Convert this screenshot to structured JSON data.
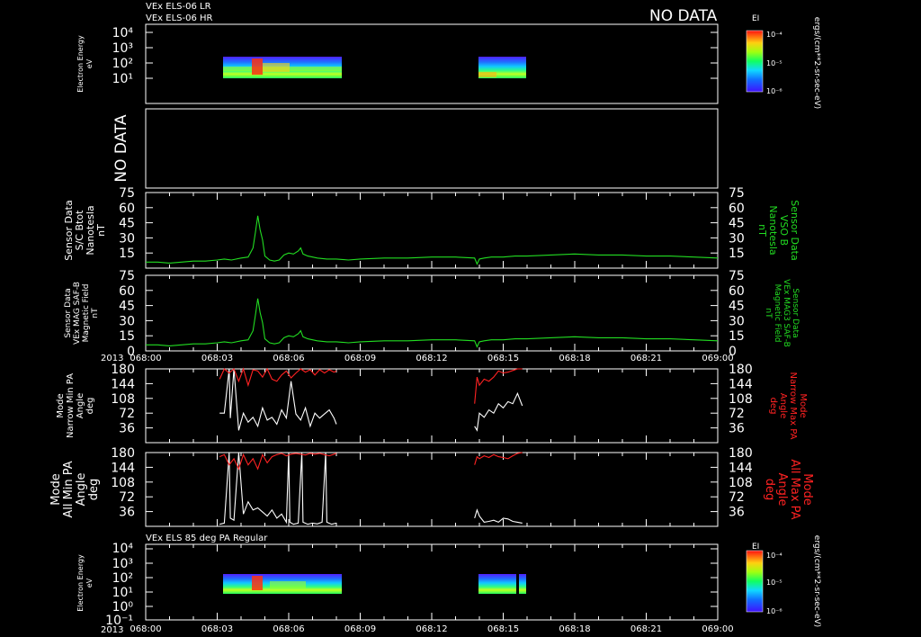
{
  "header": {
    "line1": "VEx ELS-06 LR",
    "line2": "VEx ELS-06 HR",
    "no_data": "NO DATA"
  },
  "year_label": "2013",
  "colorbar": {
    "title": "EI",
    "ticks": [
      "10⁻⁴",
      "10⁻⁵",
      "10⁻⁶"
    ],
    "unit": "ergs/(cm**2-sr-sec-eV)"
  },
  "chart_data": [
    {
      "type": "heatmap",
      "title": "VEx ELS-06 LR / VEx ELS-06 HR",
      "ylabel": [
        "Electron Energy",
        "eV"
      ],
      "yscale": "log",
      "yticks": [
        "10⁴",
        "10³",
        "10²",
        "10¹"
      ],
      "data_intervals": [
        [
          "068:03.3",
          "068:08.0"
        ],
        [
          "068:13.8",
          "068:15.8"
        ]
      ],
      "colorbar": "EI"
    },
    {
      "type": "line",
      "note_text": "NO DATA"
    },
    {
      "type": "line",
      "ylabel": [
        "Sensor Data",
        "S/C Btot",
        "Nanotesla",
        "nT"
      ],
      "ylabel_right": [
        "Sensor Data",
        "VSO B",
        "Nanotesla",
        "nT"
      ],
      "ylim": [
        0,
        75
      ],
      "yticks": [
        15,
        30,
        45,
        60,
        75
      ],
      "series": [
        {
          "name": "B",
          "color": "#22dd22",
          "x": [
            0,
            0.5,
            1.0,
            1.5,
            2.0,
            2.5,
            3.0,
            3.3,
            3.6,
            4.0,
            4.3,
            4.5,
            4.6,
            4.7,
            4.8,
            4.9,
            5.0,
            5.2,
            5.4,
            5.6,
            5.8,
            6.0,
            6.2,
            6.4,
            6.5,
            6.6,
            6.8,
            7.2,
            7.6,
            8.0,
            8.5,
            9.0,
            10.0,
            11.0,
            12.0,
            13.0,
            13.8,
            13.9,
            14.0,
            14.2,
            14.5,
            15.0,
            15.5,
            16.0,
            17.0,
            18.0,
            19.0,
            20.0,
            21.0,
            22.0,
            23.0,
            24.0
          ],
          "y": [
            6,
            6,
            5,
            6,
            7,
            7,
            8,
            9,
            8,
            10,
            11,
            20,
            35,
            52,
            38,
            28,
            12,
            8,
            7,
            8,
            13,
            15,
            14,
            17,
            20,
            14,
            12,
            10,
            9,
            9,
            8,
            9,
            10,
            10,
            11,
            11,
            10,
            4,
            9,
            10,
            11,
            11,
            12,
            12,
            13,
            14,
            13,
            13,
            12,
            12,
            11,
            10
          ]
        }
      ]
    },
    {
      "type": "line",
      "ylabel": [
        "Sensor Data",
        "VEx MAG SAF-B",
        "Magnetic Field",
        "nT"
      ],
      "ylabel_right": [
        "Sensor Data",
        "VEx MAG3 SAF-B",
        "Magnetic Field",
        "nT"
      ],
      "ylim": [
        0,
        75
      ],
      "yticks": [
        0,
        15,
        30,
        45,
        60,
        75
      ],
      "xticks": [
        "068:00",
        "068:03",
        "068:06",
        "068:09",
        "068:12",
        "068:15",
        "068:18",
        "068:21",
        "069:00"
      ],
      "series": [
        {
          "name": "B",
          "color": "#22dd22",
          "x": [
            0,
            0.5,
            1.0,
            1.5,
            2.0,
            2.5,
            3.0,
            3.3,
            3.6,
            4.0,
            4.3,
            4.5,
            4.6,
            4.7,
            4.8,
            4.9,
            5.0,
            5.2,
            5.4,
            5.6,
            5.8,
            6.0,
            6.2,
            6.4,
            6.5,
            6.6,
            6.8,
            7.2,
            7.6,
            8.0,
            8.5,
            9.0,
            10.0,
            11.0,
            12.0,
            13.0,
            13.8,
            13.9,
            14.0,
            14.2,
            14.5,
            15.0,
            15.5,
            16.0,
            17.0,
            18.0,
            19.0,
            20.0,
            21.0,
            22.0,
            23.0,
            24.0
          ],
          "y": [
            6,
            6,
            5,
            6,
            7,
            7,
            8,
            9,
            8,
            10,
            11,
            20,
            35,
            52,
            38,
            28,
            12,
            8,
            7,
            8,
            13,
            15,
            14,
            17,
            20,
            14,
            12,
            10,
            9,
            9,
            8,
            9,
            10,
            10,
            11,
            11,
            10,
            4,
            9,
            10,
            11,
            11,
            12,
            12,
            13,
            14,
            13,
            13,
            12,
            12,
            11,
            10
          ]
        }
      ]
    },
    {
      "type": "line",
      "ylabel": [
        "Mode",
        "Narrow Min PA",
        "Angle",
        "deg"
      ],
      "ylabel_right": [
        "Mode",
        "Narrow Max PA",
        "Angle",
        "deg"
      ],
      "ylim": [
        0,
        180
      ],
      "yticks": [
        36,
        72,
        108,
        144,
        180
      ],
      "series": [
        {
          "name": "Narrow Min PA",
          "color": "#ffffff",
          "segments": [
            {
              "x": [
                3.1,
                3.3,
                3.5,
                3.55,
                3.7,
                3.9,
                4.1,
                4.3,
                4.5,
                4.7,
                4.9,
                5.1,
                5.3,
                5.5,
                5.7,
                5.9,
                6.1,
                6.3,
                6.5,
                6.7,
                6.9,
                7.1,
                7.3,
                7.5,
                7.7,
                7.9,
                8.0
              ],
              "y": [
                72,
                72,
                180,
                60,
                180,
                30,
                72,
                50,
                62,
                40,
                85,
                55,
                62,
                45,
                80,
                60,
                150,
                70,
                55,
                85,
                40,
                72,
                60,
                70,
                80,
                60,
                45
              ]
            },
            {
              "x": [
                13.8,
                13.9,
                14.0,
                14.2,
                14.4,
                14.6,
                14.8,
                15.0,
                15.2,
                15.4,
                15.6,
                15.8
              ],
              "y": [
                40,
                30,
                72,
                62,
                80,
                72,
                95,
                85,
                100,
                95,
                120,
                90
              ]
            }
          ]
        },
        {
          "name": "Narrow Max PA",
          "color": "#ff2222",
          "segments": [
            {
              "x": [
                3.1,
                3.3,
                3.5,
                3.7,
                3.9,
                4.1,
                4.3,
                4.5,
                4.7,
                4.9,
                5.1,
                5.3,
                5.5,
                5.7,
                5.9,
                6.1,
                6.3,
                6.5,
                6.7,
                6.9,
                7.1,
                7.3,
                7.5,
                7.7,
                7.9,
                8.0
              ],
              "y": [
                155,
                180,
                170,
                180,
                150,
                180,
                140,
                178,
                175,
                160,
                180,
                155,
                150,
                165,
                175,
                158,
                170,
                180,
                172,
                178,
                165,
                178,
                170,
                178,
                172,
                175
              ]
            },
            {
              "x": [
                13.8,
                13.9,
                14.0,
                14.2,
                14.4,
                14.6,
                14.8,
                15.0,
                15.2,
                15.4,
                15.6,
                15.8
              ],
              "y": [
                95,
                160,
                140,
                155,
                150,
                160,
                175,
                170,
                172,
                176,
                180,
                180
              ]
            }
          ]
        }
      ]
    },
    {
      "type": "line",
      "ylabel": [
        "Mode",
        "All Min PA",
        "Angle",
        "deg"
      ],
      "ylabel_right": [
        "Mode",
        "All Max PA",
        "Angle",
        "deg"
      ],
      "ylim": [
        0,
        180
      ],
      "yticks": [
        36,
        72,
        108,
        144,
        180
      ],
      "series": [
        {
          "name": "All Min PA",
          "color": "#ffffff",
          "segments": [
            {
              "x": [
                3.1,
                3.3,
                3.5,
                3.55,
                3.7,
                3.9,
                4.1,
                4.3,
                4.5,
                4.7,
                4.9,
                5.1,
                5.3,
                5.5,
                5.7,
                5.9,
                6.0,
                6.05,
                6.2,
                6.4,
                6.55,
                6.6,
                6.8,
                7.0,
                7.2,
                7.4,
                7.55,
                7.6,
                7.8,
                8.0
              ],
              "y": [
                5,
                8,
                180,
                20,
                15,
                180,
                30,
                60,
                40,
                45,
                35,
                25,
                40,
                20,
                30,
                10,
                180,
                10,
                5,
                8,
                180,
                10,
                5,
                8,
                6,
                10,
                180,
                10,
                5,
                8
              ]
            },
            {
              "x": [
                13.8,
                13.9,
                14.0,
                14.2,
                14.4,
                14.6,
                14.8,
                15.0,
                15.2,
                15.4,
                15.6,
                15.8
              ],
              "y": [
                20,
                40,
                25,
                10,
                12,
                15,
                10,
                20,
                18,
                12,
                10,
                8
              ]
            }
          ]
        },
        {
          "name": "All Max PA",
          "color": "#ff2222",
          "segments": [
            {
              "x": [
                3.1,
                3.3,
                3.5,
                3.7,
                3.9,
                4.1,
                4.3,
                4.5,
                4.7,
                4.9,
                5.1,
                5.3,
                5.5,
                5.7,
                5.9,
                6.1,
                6.3,
                6.5,
                6.7,
                6.9,
                7.1,
                7.3,
                7.5,
                7.7,
                7.9,
                8.0
              ],
              "y": [
                170,
                175,
                150,
                165,
                140,
                175,
                150,
                165,
                140,
                175,
                155,
                170,
                175,
                178,
                172,
                176,
                178,
                176,
                174,
                178,
                176,
                178,
                175,
                172,
                176,
                178
              ]
            },
            {
              "x": [
                13.8,
                13.9,
                14.0,
                14.2,
                14.4,
                14.6,
                14.8,
                15.0,
                15.2,
                15.4,
                15.6,
                15.8
              ],
              "y": [
                150,
                170,
                165,
                172,
                168,
                175,
                170,
                168,
                165,
                172,
                178,
                180
              ]
            }
          ]
        }
      ]
    },
    {
      "type": "heatmap",
      "title": "VEx ELS 85 deg PA Regular",
      "ylabel": [
        "Electron Energy",
        "eV"
      ],
      "yscale": "log",
      "yticks": [
        "10⁴",
        "10³",
        "10²",
        "10¹",
        "10⁰",
        "10⁻¹"
      ],
      "xticks": [
        "068:00",
        "068:03",
        "068:06",
        "068:09",
        "068:12",
        "068:15",
        "068:18",
        "068:21",
        "069:00"
      ],
      "data_intervals": [
        [
          "068:03.3",
          "068:08.0"
        ],
        [
          "068:13.8",
          "068:15.8"
        ]
      ],
      "colorbar": "EI"
    }
  ]
}
